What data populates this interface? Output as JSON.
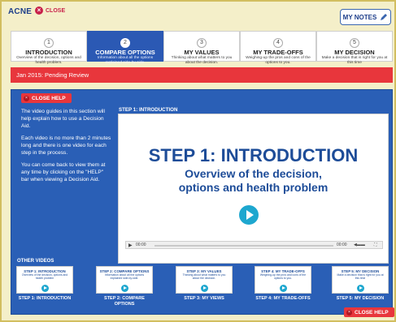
{
  "app": {
    "title": "ACNE",
    "close_label": "CLOSE"
  },
  "notes_button": {
    "label": "MY NOTES"
  },
  "steps": [
    {
      "num": "1",
      "title": "INTRODUCTION",
      "desc": "Overview of the decision, options and health problem."
    },
    {
      "num": "2",
      "title": "COMPARE OPTIONS",
      "desc": "Information about all the options explained side-by-side."
    },
    {
      "num": "3",
      "title": "MY VALUES",
      "desc": "Thinking about what matters to you about the decision."
    },
    {
      "num": "4",
      "title": "MY TRADE-OFFS",
      "desc": "Weighing-up the pros and cons of the options to you."
    },
    {
      "num": "5",
      "title": "MY DECISION",
      "desc": "Make a decision that is right for you at this time"
    }
  ],
  "banner": {
    "text": "Jan 2015: Pending Review"
  },
  "help": {
    "close_label": "CLOSE HELP",
    "paragraphs": [
      "The video guides in this section will help explain how to use a Decision Aid.",
      "Each video is no more than 2 minutes long and there is one video for each step in the process.",
      "You can come back to view them at any time by clicking on the \"HELP\" bar when viewing a Decision Aid."
    ]
  },
  "video": {
    "heading": "STEP 1: INTRODUCTION",
    "title_line1": "STEP 1: INTRODUCTION",
    "title_line2": "Overview of the decision,",
    "title_line3": "options and health problem",
    "time_current": "00:00",
    "time_total": "00:00"
  },
  "other_videos": {
    "heading": "OTHER VIDEOS",
    "items": [
      {
        "thumb_title": "STEP 1: INTRODUCTION",
        "thumb_desc": "Overview of the decision, options and health problem",
        "caption": "STEP 1: INTRODUCTION"
      },
      {
        "thumb_title": "STEP 2: COMPARE OPTIONS",
        "thumb_desc": "Information about all the options explained side-by-side.",
        "caption": "STEP 2: COMPARE OPTIONS"
      },
      {
        "thumb_title": "STEP 3: MY VALUES",
        "thumb_desc": "Thinking about what matters to you about the decision.",
        "caption": "STEP 3: MY VIEWS"
      },
      {
        "thumb_title": "STEP 4: MY TRADE-OFFS",
        "thumb_desc": "Weighing-up the pros and cons of the options to you.",
        "caption": "STEP 4: MY TRADE-OFFS"
      },
      {
        "thumb_title": "STEP 5: MY DECISION",
        "thumb_desc": "Make a decision that is right for you at this time",
        "caption": "STEP 5: MY DECISION"
      }
    ]
  },
  "colors": {
    "brand_blue": "#2a5fb6",
    "active_step": "#2b59b4",
    "banner_red": "#e8363c",
    "play_cyan": "#1ea7cf"
  }
}
